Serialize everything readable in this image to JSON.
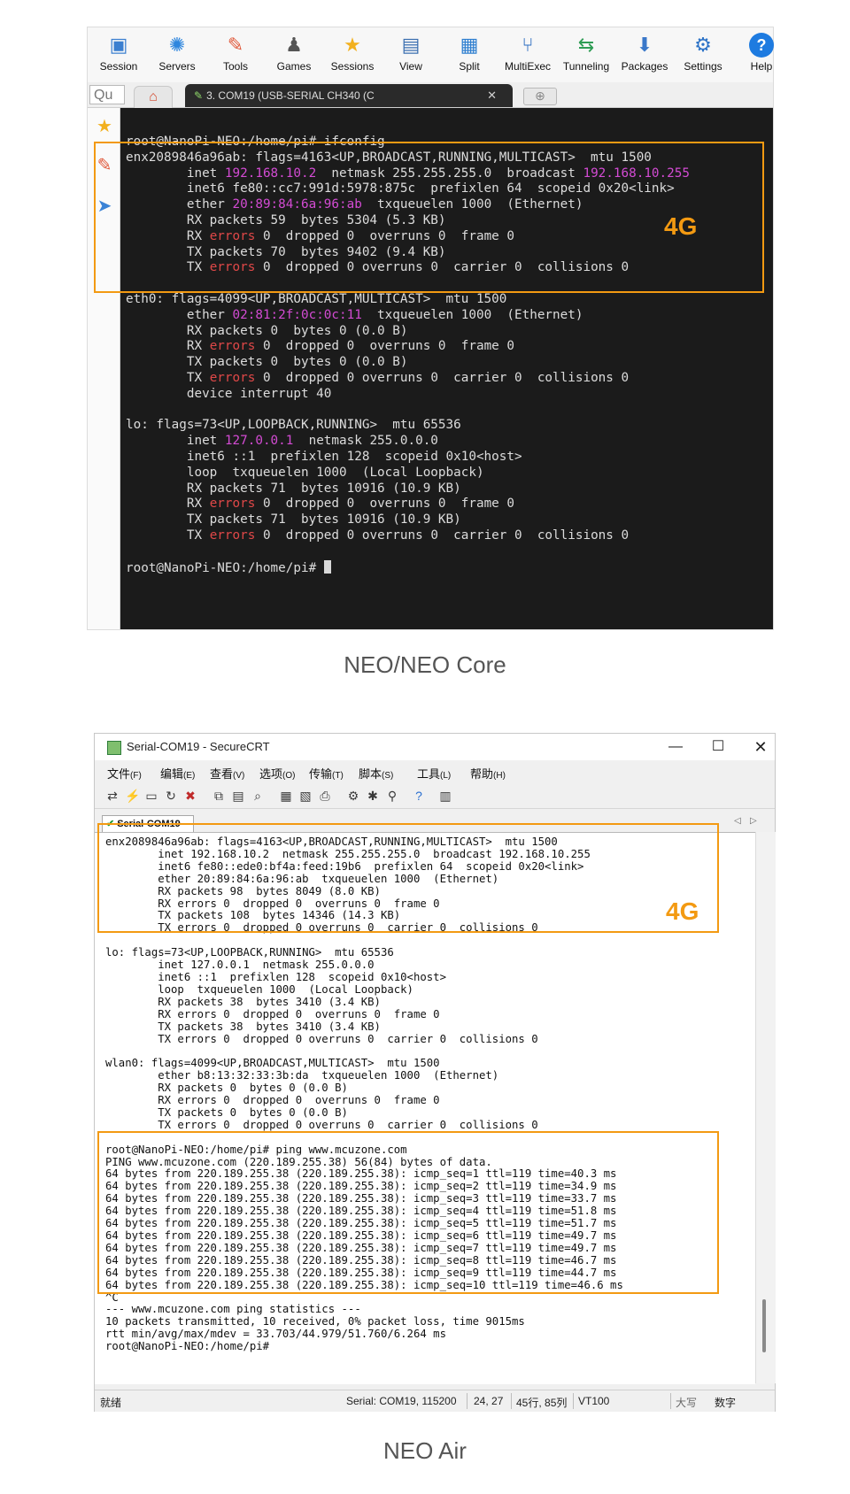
{
  "panel1": {
    "toolbar": [
      {
        "label": "Session",
        "icon": "session-icon"
      },
      {
        "label": "Servers",
        "icon": "servers-icon"
      },
      {
        "label": "Tools",
        "icon": "tools-icon"
      },
      {
        "label": "Games",
        "icon": "games-icon"
      },
      {
        "label": "Sessions",
        "icon": "sessions-star-icon"
      },
      {
        "label": "View",
        "icon": "view-icon"
      },
      {
        "label": "Split",
        "icon": "split-icon"
      },
      {
        "label": "MultiExec",
        "icon": "multiexec-icon"
      },
      {
        "label": "Tunneling",
        "icon": "tunneling-icon"
      },
      {
        "label": "Packages",
        "icon": "packages-icon"
      },
      {
        "label": "Settings",
        "icon": "settings-icon"
      },
      {
        "label": "Help",
        "icon": "help-icon"
      }
    ],
    "quick_connect": "Qu",
    "tab_title": "3. COM19  (USB-SERIAL CH340 (C",
    "terminal": {
      "prompt": "root@NanoPi-NEO:/home/pi#",
      "command": " ifconfig",
      "enx": {
        "l1": "enx2089846a96ab: flags=4163<UP,BROADCAST,RUNNING,MULTICAST>  mtu 1500",
        "inet_a": "        inet ",
        "inet_ip": "192.168.10.2",
        "inet_b": "  netmask 255.255.255.0  broadcast ",
        "inet_bc": "192.168.10.255",
        "inet6": "        inet6 fe80::cc7:991d:5978:875c  prefixlen 64  scopeid 0x20<link>",
        "ether_a": "        ether ",
        "ether_mac": "20:89:84:6a:96:ab",
        "ether_b": "  txqueuelen 1000  (Ethernet)",
        "rxp": "        RX packets 59  bytes 5304 (5.3 KB)",
        "rxe_a": "        RX ",
        "rxe_b": " 0  dropped 0  overruns 0  frame 0",
        "txp": "        TX packets 70  bytes 9402 (9.4 KB)",
        "txe_a": "        TX ",
        "txe_b": " 0  dropped 0 overruns 0  carrier 0  collisions 0"
      },
      "eth0": {
        "l1": "eth0: flags=4099<UP,BROADCAST,MULTICAST>  mtu 1500",
        "ether_a": "        ether ",
        "ether_mac": "02:81:2f:0c:0c:11",
        "ether_b": "  txqueuelen 1000  (Ethernet)",
        "rxp": "        RX packets 0  bytes 0 (0.0 B)",
        "rxe_a": "        RX ",
        "rxe_b": " 0  dropped 0  overruns 0  frame 0",
        "txp": "        TX packets 0  bytes 0 (0.0 B)",
        "txe_a": "        TX ",
        "txe_b": " 0  dropped 0 overruns 0  carrier 0  collisions 0",
        "irq": "        device interrupt 40"
      },
      "lo": {
        "l1": "lo: flags=73<UP,LOOPBACK,RUNNING>  mtu 65536",
        "inet_a": "        inet ",
        "inet_ip": "127.0.0.1",
        "inet_b": "  netmask 255.0.0.0",
        "inet6": "        inet6 ::1  prefixlen 128  scopeid 0x10<host>",
        "loop": "        loop  txqueuelen 1000  (Local Loopback)",
        "rxp": "        RX packets 71  bytes 10916 (10.9 KB)",
        "rxe_a": "        RX ",
        "rxe_b": " 0  dropped 0  overruns 0  frame 0",
        "txp": "        TX packets 71  bytes 10916 (10.9 KB)",
        "txe_a": "        TX ",
        "txe_b": " 0  dropped 0 overruns 0  carrier 0  collisions 0"
      },
      "errors_word": "errors",
      "final_prompt": "root@NanoPi-NEO:/home/pi# "
    },
    "badge": "4G",
    "caption": "NEO/NEO Core",
    "colors": {
      "highlight": "#f39a12",
      "ip_magenta": "#d34bd3",
      "error_red": "#e04848"
    }
  },
  "panel2": {
    "window_title": "Serial-COM19 - SecureCRT",
    "menu": [
      {
        "label": "文件",
        "acc": "(F)"
      },
      {
        "label": "编辑",
        "acc": "(E)"
      },
      {
        "label": "查看",
        "acc": "(V)"
      },
      {
        "label": "选项",
        "acc": "(O)"
      },
      {
        "label": "传输",
        "acc": "(T)"
      },
      {
        "label": "脚本",
        "acc": "(S)"
      },
      {
        "label": "工具",
        "acc": "(L)"
      },
      {
        "label": "帮助",
        "acc": "(H)"
      }
    ],
    "tab_label": "Serial-COM19",
    "terminal_lines": [
      "enx2089846a96ab: flags=4163<UP,BROADCAST,RUNNING,MULTICAST>  mtu 1500",
      "        inet 192.168.10.2  netmask 255.255.255.0  broadcast 192.168.10.255",
      "        inet6 fe80::ede0:bf4a:feed:19b6  prefixlen 64  scopeid 0x20<link>",
      "        ether 20:89:84:6a:96:ab  txqueuelen 1000  (Ethernet)",
      "        RX packets 98  bytes 8049 (8.0 KB)",
      "        RX errors 0  dropped 0  overruns 0  frame 0",
      "        TX packets 108  bytes 14346 (14.3 KB)",
      "        TX errors 0  dropped 0 overruns 0  carrier 0  collisions 0",
      "",
      "lo: flags=73<UP,LOOPBACK,RUNNING>  mtu 65536",
      "        inet 127.0.0.1  netmask 255.0.0.0",
      "        inet6 ::1  prefixlen 128  scopeid 0x10<host>",
      "        loop  txqueuelen 1000  (Local Loopback)",
      "        RX packets 38  bytes 3410 (3.4 KB)",
      "        RX errors 0  dropped 0  overruns 0  frame 0",
      "        TX packets 38  bytes 3410 (3.4 KB)",
      "        TX errors 0  dropped 0 overruns 0  carrier 0  collisions 0",
      "",
      "wlan0: flags=4099<UP,BROADCAST,MULTICAST>  mtu 1500",
      "        ether b8:13:32:33:3b:da  txqueuelen 1000  (Ethernet)",
      "        RX packets 0  bytes 0 (0.0 B)",
      "        RX errors 0  dropped 0  overruns 0  frame 0",
      "        TX packets 0  bytes 0 (0.0 B)",
      "        TX errors 0  dropped 0 overruns 0  carrier 0  collisions 0",
      "",
      "root@NanoPi-NEO:/home/pi# ping www.mcuzone.com",
      "PING www.mcuzone.com (220.189.255.38) 56(84) bytes of data.",
      "64 bytes from 220.189.255.38 (220.189.255.38): icmp_seq=1 ttl=119 time=40.3 ms",
      "64 bytes from 220.189.255.38 (220.189.255.38): icmp_seq=2 ttl=119 time=34.9 ms",
      "64 bytes from 220.189.255.38 (220.189.255.38): icmp_seq=3 ttl=119 time=33.7 ms",
      "64 bytes from 220.189.255.38 (220.189.255.38): icmp_seq=4 ttl=119 time=51.8 ms",
      "64 bytes from 220.189.255.38 (220.189.255.38): icmp_seq=5 ttl=119 time=51.7 ms",
      "64 bytes from 220.189.255.38 (220.189.255.38): icmp_seq=6 ttl=119 time=49.7 ms",
      "64 bytes from 220.189.255.38 (220.189.255.38): icmp_seq=7 ttl=119 time=49.7 ms",
      "64 bytes from 220.189.255.38 (220.189.255.38): icmp_seq=8 ttl=119 time=46.7 ms",
      "64 bytes from 220.189.255.38 (220.189.255.38): icmp_seq=9 ttl=119 time=44.7 ms",
      "64 bytes from 220.189.255.38 (220.189.255.38): icmp_seq=10 ttl=119 time=46.6 ms",
      "^C",
      "--- www.mcuzone.com ping statistics ---",
      "10 packets transmitted, 10 received, 0% packet loss, time 9015ms",
      "rtt min/avg/max/mdev = 33.703/44.979/51.760/6.264 ms",
      "root@NanoPi-NEO:/home/pi#"
    ],
    "badge": "4G",
    "status": {
      "ready": "就绪",
      "serial": "Serial: COM19, 115200",
      "cursor": "24,  27",
      "rows_cols": "45行, 85列",
      "emulation": "VT100",
      "caps": "大写",
      "num": "数字"
    },
    "caption": "NEO Air"
  }
}
